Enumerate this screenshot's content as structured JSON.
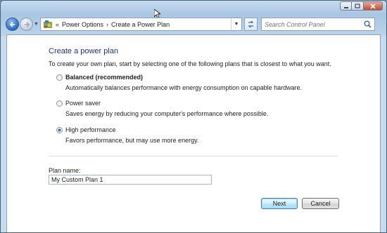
{
  "window": {
    "caption_buttons": {
      "minimize": "minimize-icon",
      "maximize": "maximize-icon",
      "close": "close-icon"
    }
  },
  "nav": {
    "back": "back-arrow-icon",
    "forward": "forward-arrow-icon",
    "breadcrumb_chevron": "«",
    "breadcrumb": [
      "Power Options",
      "Create a Power Plan"
    ],
    "separator": "›",
    "search_placeholder": "Search Control Panel"
  },
  "main": {
    "title": "Create a power plan",
    "intro": "To create your own plan, start by selecting one of the following plans that is closest to what you want.",
    "options": [
      {
        "label": "Balanced (recommended)",
        "description": "Automatically balances performance with energy consumption on capable hardware.",
        "selected": false
      },
      {
        "label": "Power saver",
        "description": "Saves energy by reducing your computer's performance where possible.",
        "selected": false
      },
      {
        "label": "High performance",
        "description": "Favors performance, but may use more energy.",
        "selected": true
      }
    ],
    "plan_name_label": "Plan name:",
    "plan_name_value": "My Custom Plan 1"
  },
  "buttons": {
    "next": "Next",
    "cancel": "Cancel"
  },
  "colors": {
    "title": "#1e3287",
    "accent": "#2a6ac0"
  }
}
